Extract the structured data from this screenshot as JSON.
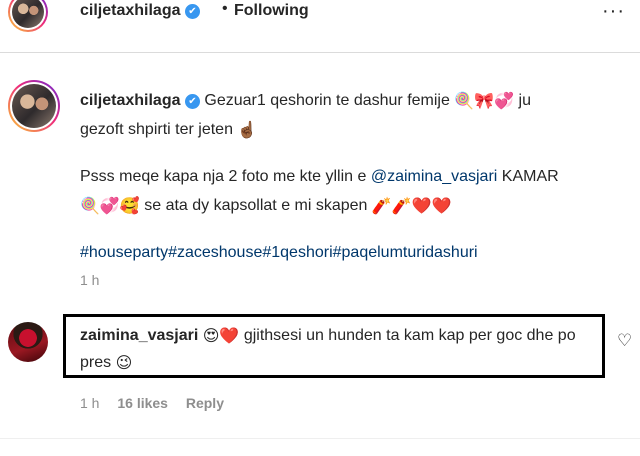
{
  "header": {
    "username": "ciljetaxhilaga",
    "verified_mark": "✔",
    "separator": "•",
    "follow_status": "Following",
    "more_label": "···"
  },
  "post": {
    "username": "ciljetaxhilaga",
    "caption": {
      "line1_text": "Gezuar1 qeshorin te dashur femije",
      "line1_emoji": "🍭🎀💞",
      "line1_tail": "ju",
      "line2_text": "gezoft shpirti ter jeten",
      "line2_emoji": "☝🏾",
      "p2_text": "Psss meqe kapa nja 2 foto me kte yllin e",
      "mention": "@zaimina_vasjari",
      "p2_tail": "KAMAR",
      "line4_emoji": "🍭💞🥰",
      "line4_text": "se ata dy kapsollat e mi skapen",
      "line4_emoji_end": "🧨🧨❤️❤️",
      "hashtags": "#houseparty#zaceshouse#1qeshori#paqelumturidashuri"
    },
    "time": "1 h"
  },
  "comment": {
    "username": "zaimina_vasjari",
    "emoji_start": "😍❤️",
    "text": "gjithsesi un hunden ta kam kap per goc dhe po pres",
    "emoji_end": "😉",
    "time": "1 h",
    "likes": "16 likes",
    "reply_label": "Reply",
    "like_icon": "♡"
  },
  "colors": {
    "link": "#00376b",
    "muted": "#8e8e8e",
    "verified": "#3897f0",
    "highlight_border": "#000000"
  }
}
